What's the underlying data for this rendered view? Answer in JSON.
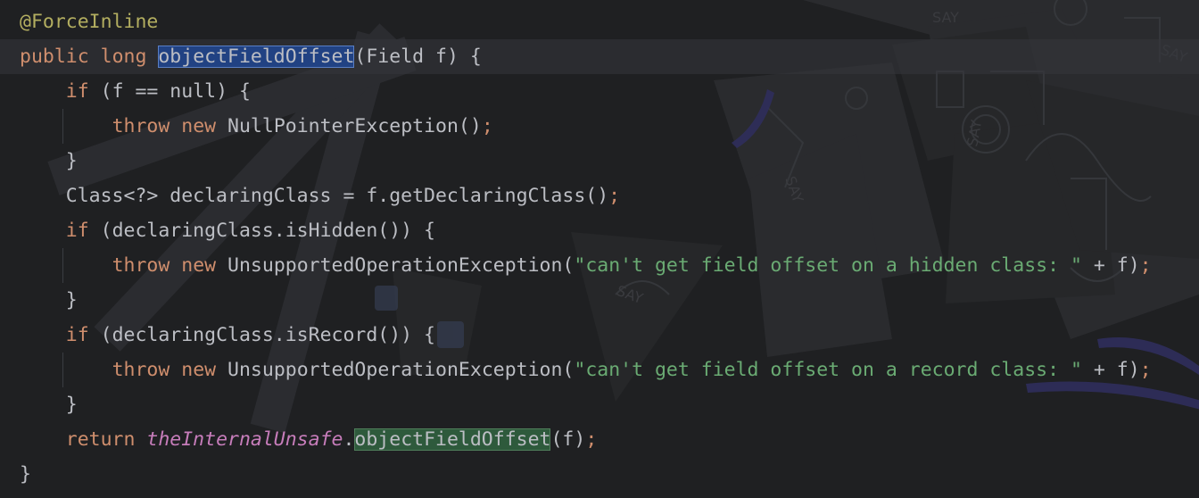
{
  "code": {
    "annotation": "@ForceInline",
    "sig_public": "public",
    "sig_long": "long",
    "sig_method": "objectFieldOffset",
    "sig_params": "(Field f) {",
    "if_kw": "if",
    "null_check_cond": "(f == null) {",
    "throw_kw": "throw",
    "new_kw": "new",
    "npe": "NullPointerException()",
    "semicolon": ";",
    "close_brace": "}",
    "class_decl": "Class<?> declaringClass = f.getDeclaringClass()",
    "hidden_cond": "(declaringClass.isHidden()) {",
    "uoe_open": "UnsupportedOperationException(",
    "hidden_msg": "\"can't get field offset on a hidden class: \"",
    "concat_f": " + f)",
    "record_cond": "(declaringClass.isRecord()) {",
    "record_msg": "\"can't get field offset on a record class: \"",
    "return_kw": "return",
    "unsafe_field": "theInternalUnsafe",
    "dot": ".",
    "call_method": "objectFieldOffset",
    "call_args": "(f)"
  },
  "colors": {
    "background": "#1f2022",
    "text": "#bcbec4",
    "keyword": "#cf8e6d",
    "annotation": "#b3ae60",
    "string": "#6aab73",
    "static_field": "#c77dbb",
    "selection": "#214283",
    "usage_highlight": "#2e5a3c"
  }
}
